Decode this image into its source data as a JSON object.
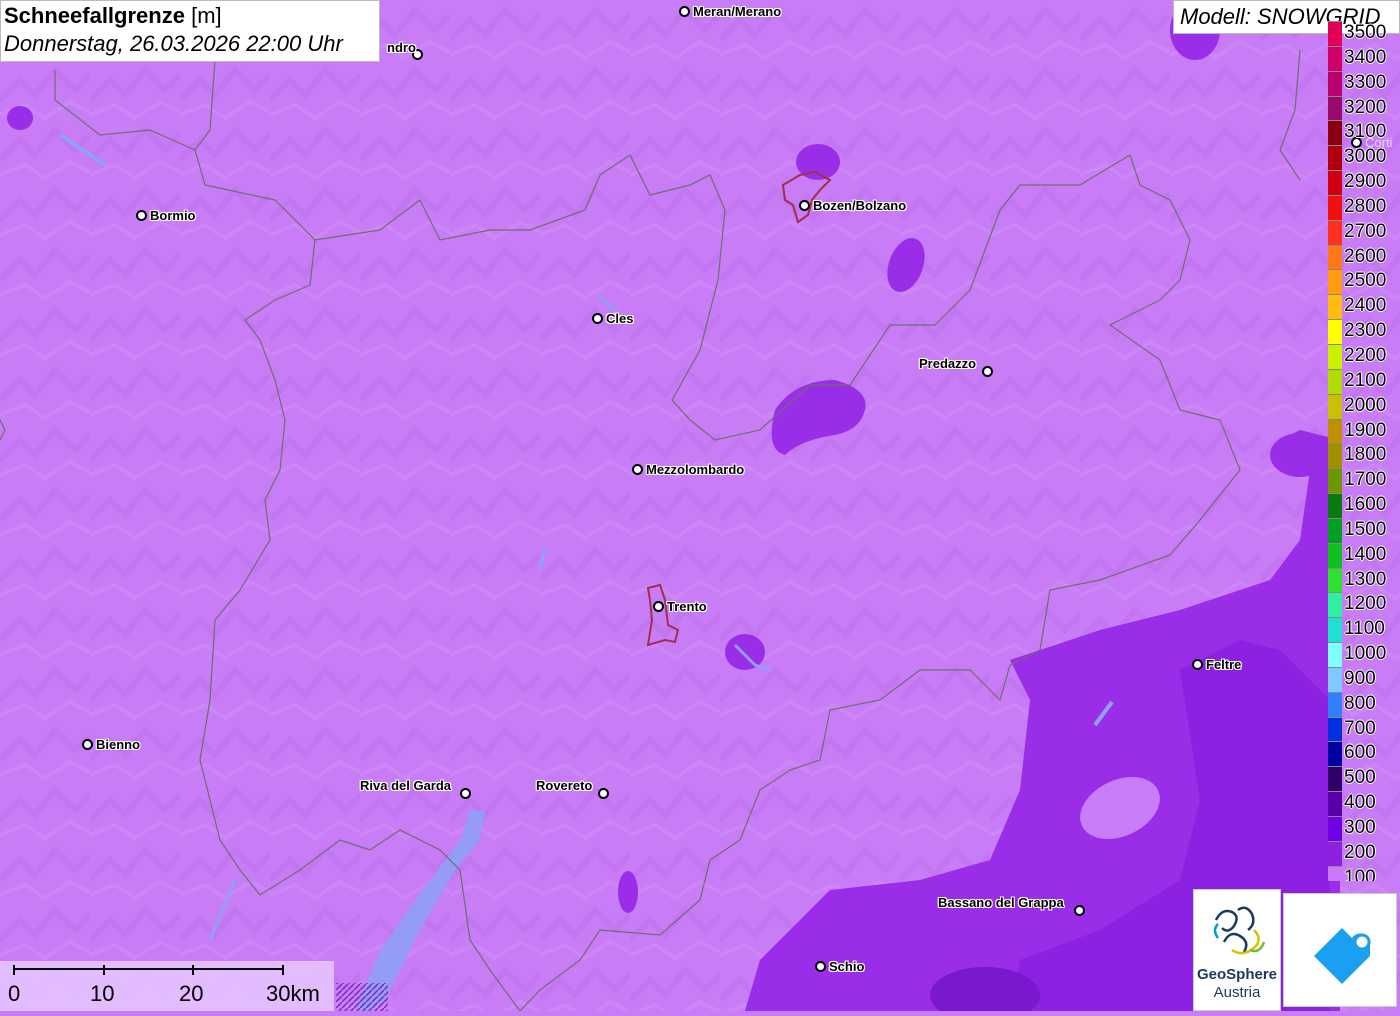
{
  "title": {
    "main": "Schneefallgrenze",
    "unit": "[m]",
    "datetime": "Donnerstag, 26.03.2026 22:00 Uhr"
  },
  "model_label": "Modell: SNOWGRID",
  "cities": [
    {
      "name": "Meran/Merano",
      "key": "meran"
    },
    {
      "name": "ndro",
      "key": "sondrio"
    },
    {
      "name": "Bozen/Bolzano",
      "key": "bozen"
    },
    {
      "name": "Bormio",
      "key": "bormio"
    },
    {
      "name": "Cles",
      "key": "cles"
    },
    {
      "name": "Predazzo",
      "key": "predazzo"
    },
    {
      "name": "Mezzolombardo",
      "key": "mezzolombardo"
    },
    {
      "name": "Trento",
      "key": "trento"
    },
    {
      "name": "Feltre",
      "key": "feltre"
    },
    {
      "name": "Bienno",
      "key": "bienno"
    },
    {
      "name": "Riva del Garda",
      "key": "riva"
    },
    {
      "name": "Rovereto",
      "key": "rovereto"
    },
    {
      "name": "Bassano del Grappa",
      "key": "bassano"
    },
    {
      "name": "Schio",
      "key": "schio"
    },
    {
      "name": "Corti",
      "key": "cortina"
    }
  ],
  "legend": [
    {
      "value": "3500",
      "color": "#e0005a"
    },
    {
      "value": "3400",
      "color": "#d0006a"
    },
    {
      "value": "3300",
      "color": "#b8006e"
    },
    {
      "value": "3200",
      "color": "#9a0a6a"
    },
    {
      "value": "3100",
      "color": "#8a0010"
    },
    {
      "value": "3000",
      "color": "#b00010"
    },
    {
      "value": "2900",
      "color": "#d00010"
    },
    {
      "value": "2800",
      "color": "#f01010"
    },
    {
      "value": "2700",
      "color": "#ff3020"
    },
    {
      "value": "2600",
      "color": "#ff7818"
    },
    {
      "value": "2500",
      "color": "#ff9c10"
    },
    {
      "value": "2400",
      "color": "#ffbc10"
    },
    {
      "value": "2300",
      "color": "#ffff00"
    },
    {
      "value": "2200",
      "color": "#c8f000"
    },
    {
      "value": "2100",
      "color": "#b0dc00"
    },
    {
      "value": "2000",
      "color": "#c8c000"
    },
    {
      "value": "1900",
      "color": "#c09000"
    },
    {
      "value": "1800",
      "color": "#a09000"
    },
    {
      "value": "1700",
      "color": "#6a9800"
    },
    {
      "value": "1600",
      "color": "#0a7a10"
    },
    {
      "value": "1500",
      "color": "#00a020"
    },
    {
      "value": "1400",
      "color": "#10c020"
    },
    {
      "value": "1300",
      "color": "#30e030"
    },
    {
      "value": "1200",
      "color": "#30f0a0"
    },
    {
      "value": "1100",
      "color": "#20e0d0"
    },
    {
      "value": "1000",
      "color": "#80ffff"
    },
    {
      "value": "900",
      "color": "#80c8ff"
    },
    {
      "value": "800",
      "color": "#3080ff"
    },
    {
      "value": "700",
      "color": "#0030e0"
    },
    {
      "value": "600",
      "color": "#0000a0"
    },
    {
      "value": "500",
      "color": "#300068"
    },
    {
      "value": "400",
      "color": "#5a00a8"
    },
    {
      "value": "300",
      "color": "#7000e8"
    },
    {
      "value": "200",
      "color": "#9020e0"
    },
    {
      "value": "100",
      "color": "#c878f8"
    }
  ],
  "scale": {
    "ticks": [
      "0",
      "10",
      "20",
      "30km"
    ]
  },
  "logos": {
    "geosphere_line1": "GeoSphere",
    "geosphere_line2": "Austria"
  },
  "colors": {
    "background": "#c87cf6",
    "zone_200": "#9a2ee8",
    "zone_300": "#8a1ee0",
    "border": "#707070"
  }
}
